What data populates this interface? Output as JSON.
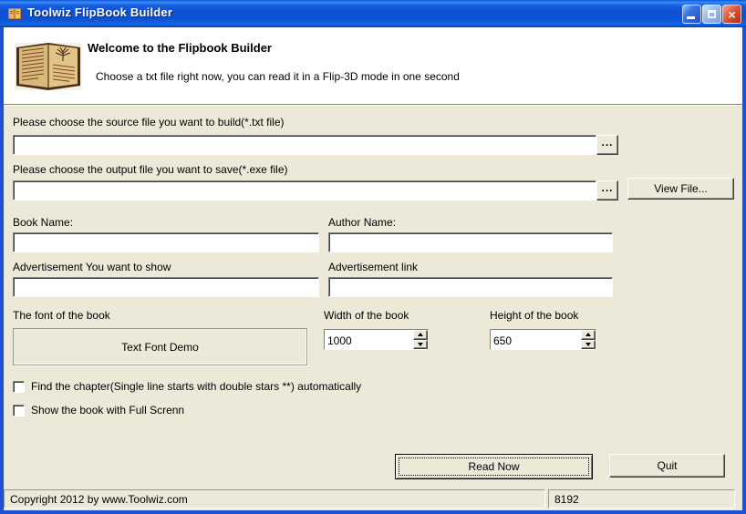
{
  "window": {
    "title": "Toolwiz FlipBook Builder"
  },
  "icons": {
    "app_icon": "book-icon",
    "minimize": "minimize-icon",
    "maximize": "maximize-icon",
    "close_glyph": "×",
    "spinner_up": "up-arrow",
    "spinner_down": "down-arrow"
  },
  "colors": {
    "titlebar_blue": "#0d52d5",
    "window_border_blue": "#1e51d4",
    "dialog_bg": "#ece9d8",
    "close_red": "#e0583a",
    "header_bg": "#ffffff"
  },
  "header": {
    "title": "Welcome to the Flipbook Builder",
    "subtitle": "Choose a txt file right now, you can read it in a Flip-3D mode in one second"
  },
  "form": {
    "source": {
      "label": "Please choose the source file you want to build(*.txt file)",
      "value": "",
      "browse_label": "..."
    },
    "output": {
      "label": "Please choose the output file you want to save(*.exe file)",
      "value": "",
      "browse_label": "...",
      "view_file_label": "View File..."
    },
    "book_name": {
      "label": "Book Name:",
      "value": ""
    },
    "author_name": {
      "label": "Author Name:",
      "value": ""
    },
    "ad_show": {
      "label": "Advertisement You want to show",
      "value": ""
    },
    "ad_link": {
      "label": "Advertisement link",
      "value": ""
    },
    "font": {
      "label": "The font of the book",
      "demo_label": "Text Font Demo"
    },
    "width": {
      "label": "Width of the book",
      "value": "1000"
    },
    "height": {
      "label": "Height of the book",
      "value": "650"
    },
    "checkboxes": [
      {
        "label": "Find the chapter(Single line starts with double stars **) automatically",
        "checked": false
      },
      {
        "label": "Show the book with Full Screnn",
        "checked": false
      }
    ],
    "read_now_label": "Read Now",
    "quit_label": "Quit"
  },
  "statusbar": {
    "left": "Copyright 2012 by www.Toolwiz.com",
    "right": "8192"
  }
}
